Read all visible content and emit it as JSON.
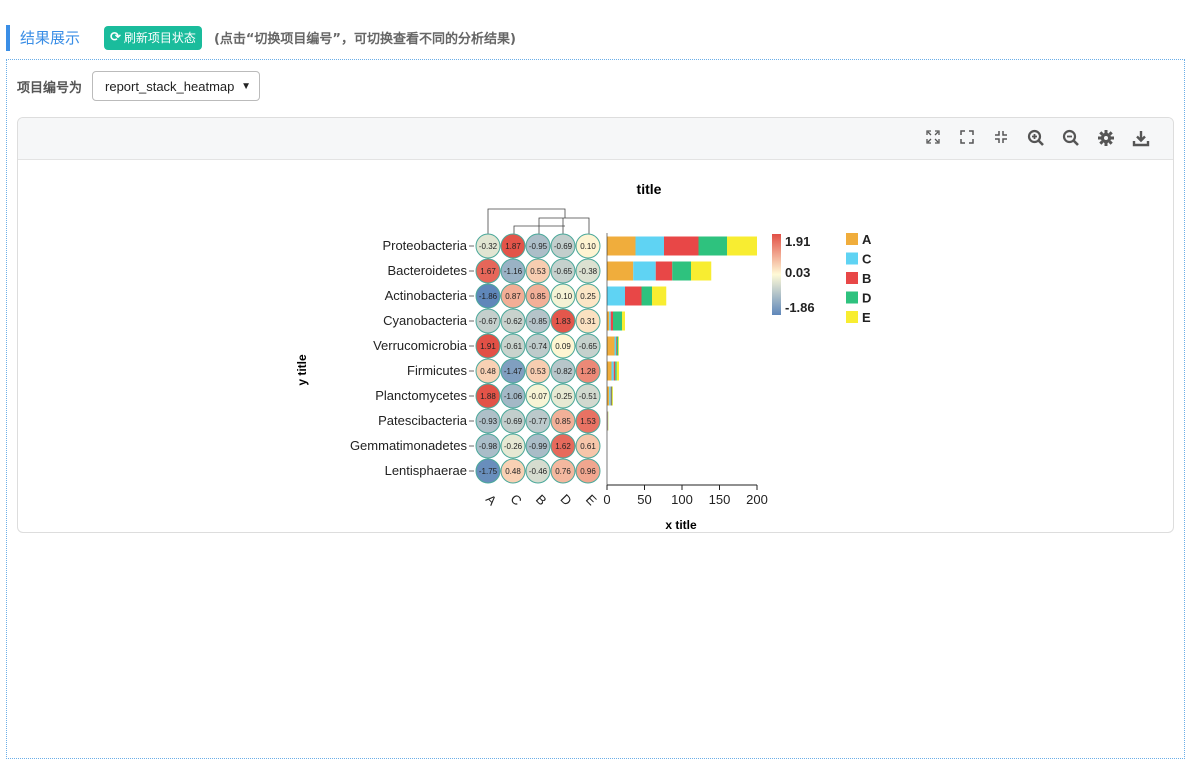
{
  "header": {
    "title": "结果展示",
    "refresh_label": "刷新项目状态",
    "note": "(点击“切换项目编号”，可切换查看不同的分析结果)"
  },
  "selector": {
    "label": "项目编号为",
    "value": "report_stack_heatmap"
  },
  "toolbar": {
    "icons": [
      "expand-icon",
      "fullscreen-icon",
      "shrink-icon",
      "zoom-in-icon",
      "zoom-out-icon",
      "settings-icon",
      "download-icon"
    ]
  },
  "colors": {
    "accent": "#3a8ee6",
    "refresh": "#1abc9c",
    "A": "#f0ad3c",
    "C": "#5fd3f3",
    "B": "#e84747",
    "D": "#2ec27e",
    "E": "#f8ed31"
  },
  "chart_data": [
    {
      "type": "heatmap",
      "title": "title",
      "ylabel": "y title",
      "rows": [
        "Proteobacteria",
        "Bacteroidetes",
        "Actinobacteria",
        "Cyanobacteria",
        "Verrucomicrobia",
        "Firmicutes",
        "Planctomycetes",
        "Patescibacteria",
        "Gemmatimonadetes",
        "Lentisphaerae"
      ],
      "columns": [
        "A",
        "C",
        "B",
        "D",
        "E"
      ],
      "values": [
        [
          "-0.32",
          "1.87",
          "-0.95",
          "-0.69",
          "0.10"
        ],
        [
          "1.67",
          "-1.16",
          "0.53",
          "-0.65",
          "-0.38"
        ],
        [
          "-1.86",
          "0.87",
          "0.85",
          "-0.10",
          "0.25"
        ],
        [
          "-0.67",
          "-0.62",
          "-0.85",
          "1.83",
          "0.31"
        ],
        [
          "1.91",
          "-0.61",
          "-0.74",
          "0.09",
          "-0.65"
        ],
        [
          "0.48",
          "-1.47",
          "0.53",
          "-0.82",
          "1.28"
        ],
        [
          "1.88",
          "-1.06",
          "-0.07",
          "-0.25",
          "-0.51"
        ],
        [
          "-0.93",
          "-0.69",
          "-0.77",
          "0.85",
          "1.53"
        ],
        [
          "-0.98",
          "-0.26",
          "-0.99",
          "1.62",
          "0.61"
        ],
        [
          "-1.75",
          "0.48",
          "-0.46",
          "0.76",
          "0.96"
        ]
      ],
      "colorbar": {
        "max": "1.91",
        "mid": "0.03",
        "min": "-1.86"
      }
    },
    {
      "type": "bar",
      "stacked": true,
      "orientation": "horizontal",
      "xlabel": "x title",
      "xlim": [
        0,
        200
      ],
      "xticks": [
        "0",
        "50",
        "100",
        "150",
        "200"
      ],
      "categories": [
        "Proteobacteria",
        "Bacteroidetes",
        "Actinobacteria",
        "Cyanobacteria",
        "Verrucomicrobia",
        "Firmicutes",
        "Planctomycetes",
        "Patescibacteria",
        "Gemmatimonadetes",
        "Lentisphaerae"
      ],
      "series": [
        {
          "name": "A",
          "values": [
            38,
            35,
            0,
            3,
            10,
            6,
            3,
            0.5,
            0,
            0
          ]
        },
        {
          "name": "C",
          "values": [
            38,
            30,
            24,
            2,
            2,
            3,
            2,
            0.5,
            0,
            0
          ]
        },
        {
          "name": "B",
          "values": [
            46,
            22,
            22,
            3,
            1,
            2,
            1,
            0.3,
            0,
            0
          ]
        },
        {
          "name": "D",
          "values": [
            38,
            25,
            14,
            12,
            2,
            2,
            1,
            0.3,
            0,
            0
          ]
        },
        {
          "name": "E",
          "values": [
            40,
            27,
            19,
            4,
            1,
            3,
            1,
            0.3,
            0,
            0
          ]
        }
      ],
      "legend": [
        "A",
        "C",
        "B",
        "D",
        "E"
      ]
    }
  ]
}
